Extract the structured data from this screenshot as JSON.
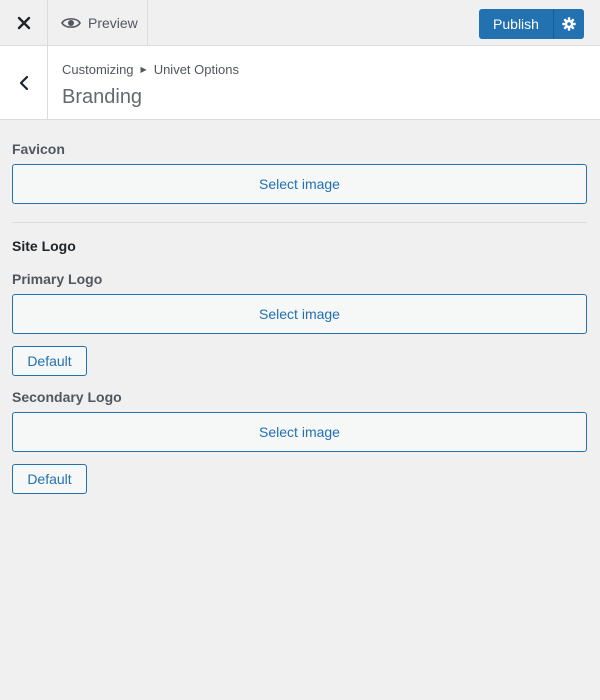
{
  "topbar": {
    "close_icon": "close-icon",
    "preview_label": "Preview",
    "publish_label": "Publish",
    "settings_icon": "gear-icon"
  },
  "section": {
    "breadcrumb_root": "Customizing",
    "breadcrumb_parent": "Univet Options",
    "title": "Branding"
  },
  "controls": {
    "favicon_label": "Favicon",
    "favicon_button": "Select image",
    "site_logo_heading": "Site Logo",
    "primary_logo_label": "Primary Logo",
    "primary_logo_button": "Select image",
    "primary_default": "Default",
    "secondary_logo_label": "Secondary Logo",
    "secondary_logo_button": "Select image",
    "secondary_default": "Default"
  },
  "colors": {
    "accent": "#2271b1",
    "background": "#f0f0f1"
  }
}
